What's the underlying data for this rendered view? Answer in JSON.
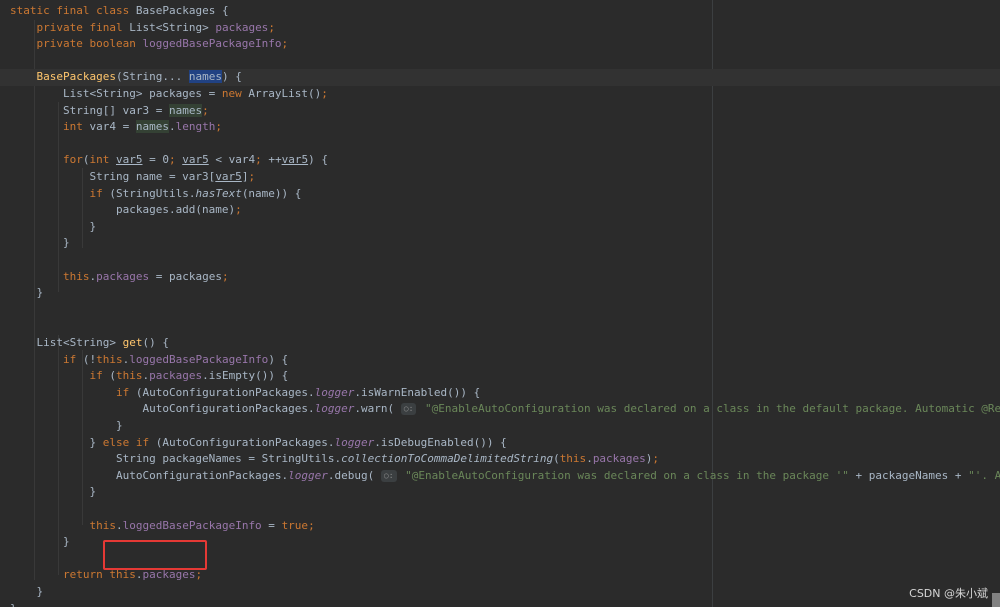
{
  "editor": {
    "lines": [
      "static final class BasePackages {",
      "    private final List<String> packages;",
      "    private boolean loggedBasePackageInfo;",
      "",
      "    BasePackages(String... names) {",
      "        List<String> packages = new ArrayList();",
      "        String[] var3 = names;",
      "        int var4 = names.length;",
      "",
      "        for(int var5 = 0; var5 < var4; ++var5) {",
      "            String name = var3[var5];",
      "            if (StringUtils.hasText(name)) {",
      "                packages.add(name);",
      "            }",
      "        }",
      "",
      "        this.packages = packages;",
      "    }",
      "",
      "",
      "    List<String> get() {",
      "        if (!this.loggedBasePackageInfo) {",
      "            if (this.packages.isEmpty()) {",
      "                if (AutoConfigurationPackages.logger.isWarnEnabled()) {",
      "                    AutoConfigurationPackages.logger.warn( ○: \"@EnableAutoConfiguration was declared on a class in the default package. Automatic @Repository and @En",
      "                }",
      "            } else if (AutoConfigurationPackages.logger.isDebugEnabled()) {",
      "                String packageNames = StringUtils.collectionToCommaDelimitedString(this.packages);",
      "                AutoConfigurationPackages.logger.debug( ○: \"@EnableAutoConfiguration was declared on a class in the package '\" + packageNames + \"'. Automatic @Reposi",
      "            }",
      "",
      "            this.loggedBasePackageInfo = true;",
      "        }",
      "",
      "        return this.packages;",
      "    }",
      "}"
    ],
    "param_hint_label": "○:"
  },
  "watermark": "CSDN @朱小斌",
  "colors": {
    "background": "#2b2b2b",
    "keyword": "#cc7832",
    "field": "#9876aa",
    "method_decl": "#ffc66d",
    "string": "#6a8759",
    "plain": "#a9b7c6",
    "annotation_box": "#e53935"
  }
}
